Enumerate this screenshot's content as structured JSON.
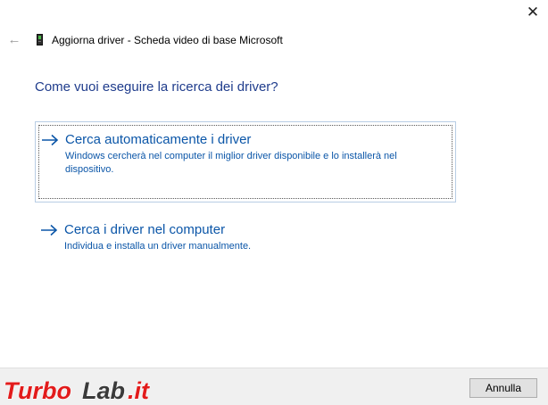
{
  "window": {
    "title": "Aggiorna driver - Scheda video di base Microsoft",
    "close_glyph": "✕",
    "back_glyph": "←",
    "icons": [
      "back-arrow-icon",
      "display-device-icon",
      "close-icon"
    ]
  },
  "main": {
    "heading": "Come vuoi eseguire la ricerca dei driver?",
    "options": [
      {
        "title": "Cerca automaticamente i driver",
        "description": "Windows cercherà nel computer il miglior driver disponibile e lo installerà nel dispositivo.",
        "icon": "right-arrow-icon",
        "focused": true
      },
      {
        "title": "Cerca i driver nel computer",
        "description": "Individua e installa un driver manualmente.",
        "icon": "right-arrow-icon",
        "focused": false
      }
    ]
  },
  "footer": {
    "cancel_label": "Annulla"
  },
  "watermark": {
    "text": "TurboLab.it"
  },
  "colors": {
    "heading": "#1f3c8c",
    "link": "#0b56a8",
    "focus_border": "#b8cde4",
    "footer_bg": "#f0f0f0",
    "button_bg": "#e1e1e1",
    "watermark_red": "#e21b1b",
    "watermark_dark": "#3a3a3a"
  }
}
